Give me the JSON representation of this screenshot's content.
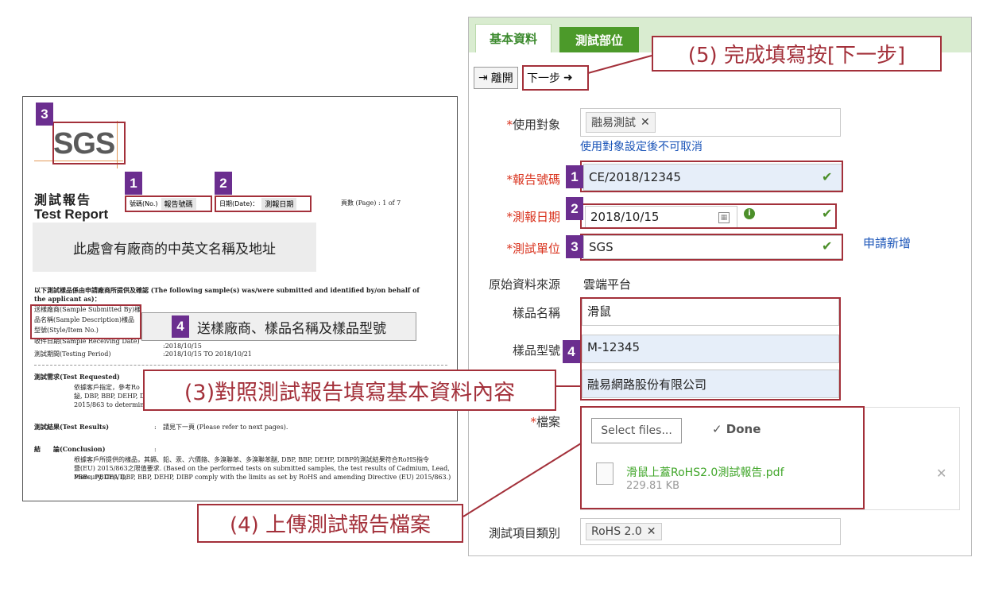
{
  "report": {
    "logo": "SGS",
    "title_zh": "測試報告",
    "title_en": "Test Report",
    "no_label": "號碼(No.)",
    "no_value": "報告號碼",
    "date_label": "日期(Date)：",
    "date_value": "測報日期",
    "page_label": "頁數 (Page) : 1 of 7",
    "company_note": "此處會有廠商的中英文名稱及地址",
    "intro_line1": "以下測試樣品係由申請廠商所提供及確認 (The following sample(s) was/were submitted and identified by/on behalf of",
    "intro_line2": "the applicant as)：",
    "sample_by": "送樣廠商(Sample Submitted By)樣",
    "sample_desc": "品名稱(Sample Description)樣品",
    "sample_style": "型號(Style/Item No.)",
    "sample_note": "送樣廠商、樣品名稱及樣品型號",
    "receiving_label": "收件日期(Sample Receiving Date)",
    "receiving_value": ":2018/10/15",
    "testing_label": "測試期間(Testing Period)",
    "testing_value": ":2018/10/15 TO 2018/10/21",
    "requested_label": "測試需求(Test Requested)",
    "requested_line1": "依據客戶指定，參考Ro",
    "requested_line2": "鉍, DBP, BBP, DEHP, D",
    "requested_line3": "2015/863 to determine C",
    "results_label": "測試結果(Test Results)",
    "results_value": "請見下一頁 (Please refer to next pages).",
    "conclusion_label": "結　　論(Conclusion)",
    "conclusion_line1": "根據客戶所提供的樣品，其鎘、鉛、汞、六價鉻、多溴聯苯、多溴聯苯醚, DBP, BBP, DEHP, DIBP的測試結果符合RoHS指令",
    "conclusion_line2": "暨(EU) 2015/863之限值要求. (Based on the performed tests on submitted samples, the test results of Cadmium, Lead, Mercury, Cr(VI),",
    "conclusion_line3": "PBBs, PBDEs, DBP, BBP, DEHP, DIBP comply with the limits as set by RoHS and amending Directive (EU) 2015/863.)"
  },
  "form": {
    "tabs": [
      "基本資料",
      "測試部位"
    ],
    "leave_button": "離開",
    "next_button": "下一步",
    "fields": {
      "target_label": "使用對象",
      "target_tag": "融易測試",
      "target_hint": "使用對象設定後不可取消",
      "report_no_label": "報告號碼",
      "report_no_value": "CE/2018/12345",
      "date_label": "測報日期",
      "date_value": "2018/10/15",
      "unit_label": "測試單位",
      "unit_value": "SGS",
      "apply_link": "申請新增",
      "source_label": "原始資料來源",
      "source_value": "雲端平台",
      "sample_name_label": "樣品名稱",
      "sample_name_value": "滑鼠",
      "sample_model_label": "樣品型號",
      "sample_model_value": "M-12345",
      "company_value": "融易網路股份有限公司",
      "file_label": "檔案",
      "select_files": "Select files...",
      "done": "Done",
      "file_name": "滑鼠上蓋RoHS2.0測試報告.pdf",
      "file_size": "229.81 KB",
      "category_label": "測試項目類別",
      "category_tag": "RoHS 2.0"
    }
  },
  "badges": [
    "1",
    "2",
    "3",
    "4"
  ],
  "callouts": {
    "step3": "(3)對照測試報告填寫基本資料內容",
    "step4": "(4) 上傳測試報告檔案",
    "step5": "(5) 完成填寫按[下一步]"
  },
  "colors": {
    "accent_red": "#a3303a",
    "badge_purple": "#6b2e8f",
    "tab_green": "#4c9a2a",
    "link_blue": "#1a54b8",
    "check_green": "#4c8f2a"
  },
  "icons": [
    "exit-icon",
    "arrow-right-icon",
    "remove-tag-icon",
    "calendar-icon",
    "info-icon",
    "check-icon",
    "file-icon",
    "remove-file-icon"
  ]
}
